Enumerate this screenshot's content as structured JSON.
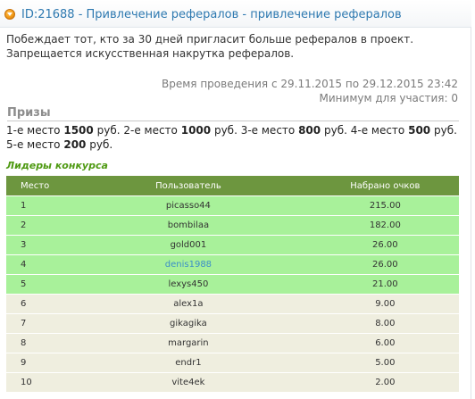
{
  "header": {
    "title": "ID:21688 - Привлечение рефералов - привлечение рефералов"
  },
  "description": "Побеждает тот, кто за 30 дней пригласит больше рефералов в проект. Запрещается искусственная накрутка рефералов.",
  "meta": {
    "period": "Время проведения с 29.11.2015 по 29.12.2015 23:42",
    "minimum": "Минимум для участия: 0"
  },
  "prizes": {
    "heading": "Призы",
    "items": [
      {
        "place": "1-е место",
        "amount": "1500",
        "currency": "руб."
      },
      {
        "place": "2-е место",
        "amount": "1000",
        "currency": "руб."
      },
      {
        "place": "3-е место",
        "amount": "800",
        "currency": "руб."
      },
      {
        "place": "4-е место",
        "amount": "500",
        "currency": "руб."
      },
      {
        "place": "5-е место",
        "amount": "200",
        "currency": "руб."
      }
    ]
  },
  "leaders": {
    "title": "Лидеры конкурса",
    "columns": [
      "Место",
      "Пользователь",
      "Набрано очков"
    ],
    "rows": [
      {
        "place": "1",
        "user": "picasso44",
        "score": "215.00",
        "highlight": true
      },
      {
        "place": "2",
        "user": "bombilaa",
        "score": "182.00",
        "highlight": true
      },
      {
        "place": "3",
        "user": "gold001",
        "score": "26.00",
        "highlight": true
      },
      {
        "place": "4",
        "user": "denis1988",
        "score": "26.00",
        "highlight": true,
        "link": true
      },
      {
        "place": "5",
        "user": "lexys450",
        "score": "21.00",
        "highlight": true
      },
      {
        "place": "6",
        "user": "alex1a",
        "score": "9.00",
        "highlight": false
      },
      {
        "place": "7",
        "user": "gikagika",
        "score": "8.00",
        "highlight": false
      },
      {
        "place": "8",
        "user": "margarin",
        "score": "6.00",
        "highlight": false
      },
      {
        "place": "9",
        "user": "endr1",
        "score": "5.00",
        "highlight": false
      },
      {
        "place": "10",
        "user": "vite4ek",
        "score": "2.00",
        "highlight": false
      }
    ]
  },
  "colors": {
    "title_link": "#2e79b0",
    "table_header": "#6d963f",
    "top_row": "#a8f19a",
    "normal_row": "#efeedf",
    "leaders_title": "#4f9a13"
  },
  "icons": {
    "header_icon": "orange-circle-arrow-icon"
  }
}
